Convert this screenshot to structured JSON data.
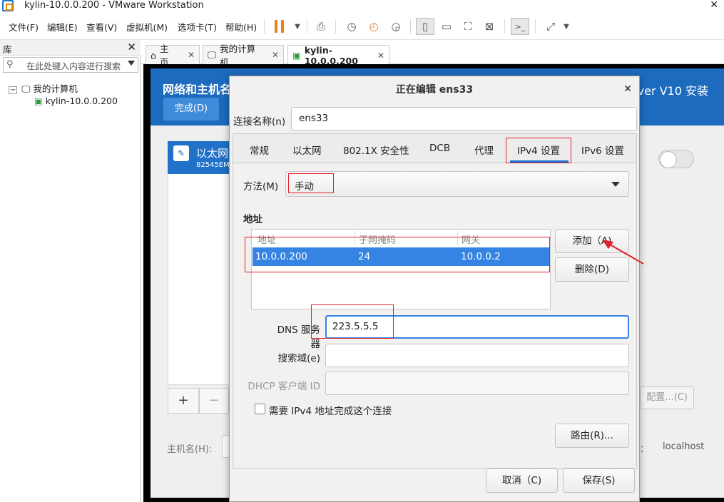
{
  "window": {
    "title": "kylin-10.0.0.200 - VMware Workstation",
    "close": "✕"
  },
  "menu": {
    "file": "文件(F)",
    "edit": "编辑(E)",
    "view": "查看(V)",
    "vm": "虚拟机(M)",
    "tabs": "选项卡(T)",
    "help": "帮助(H)"
  },
  "library": {
    "title": "库",
    "close": "✕",
    "search_placeholder": "在此处键入内容进行搜索",
    "tree": [
      {
        "label": "我的计算机"
      },
      {
        "label": "kylin-10.0.0.200"
      }
    ]
  },
  "tabs": [
    {
      "label": "主页"
    },
    {
      "label": "我的计算机"
    },
    {
      "label": "kylin-10.0.0.200"
    }
  ],
  "guest": {
    "heading": "网络和主机名",
    "done_button": "完成(D)",
    "product": "rver V10 安装",
    "ethernet_name": "以太网",
    "ethernet_model": "82545EM",
    "hostname_label": "主机名(H):",
    "configure_button": "配置...(C)",
    "current_host_colon": "：",
    "current_host": "localhost",
    "add_symbol": "+",
    "remove_symbol": "−"
  },
  "dialog": {
    "title": "正在编辑 ens33",
    "close": "✕",
    "connection_name_label": "连接名称(n)",
    "connection_name_value": "ens33",
    "tabs": [
      "常规",
      "以太网",
      "802.1X 安全性",
      "DCB",
      "代理",
      "IPv4 设置",
      "IPv6 设置"
    ],
    "active_tab": "IPv4 设置",
    "method_label": "方法(M)",
    "method_value": "手动",
    "address_heading": "地址",
    "address_columns": [
      "地址",
      "子网掩码",
      "网关"
    ],
    "address_rows": [
      {
        "address": "10.0.0.200",
        "netmask": "24",
        "gateway": "10.0.0.2"
      }
    ],
    "add_button": "添加（A)",
    "delete_button": "删除(D)",
    "dns_label": "DNS 服务器",
    "dns_value": "223.5.5.5",
    "search_domain_label": "搜索域(e)",
    "search_domain_value": "",
    "dhcp_client_id_label": "DHCP 客户端 ID",
    "dhcp_client_id_value": "",
    "require_ipv4_label": "需要 IPv4 地址完成这个连接",
    "require_ipv4_checked": false,
    "routes_button": "路由(R)...",
    "cancel_button": "取消（C)",
    "save_button": "保存(S)"
  },
  "colors": {
    "accent": "#3584e4",
    "kylin_header": "#1c6bbf",
    "annotation": "#e0202a",
    "pause": "#f07f1a"
  }
}
